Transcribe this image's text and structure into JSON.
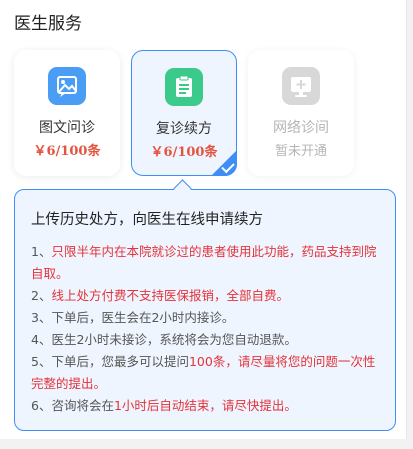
{
  "section_title": "医生服务",
  "services": [
    {
      "label": "图文问诊",
      "price": "￥6/100条",
      "icon": "image-chat-icon",
      "color": "#4a9df5",
      "state": "normal"
    },
    {
      "label": "复诊续方",
      "price": "￥6/100条",
      "icon": "prescription-icon",
      "color": "#3cc98c",
      "state": "selected"
    },
    {
      "label": "网络诊间",
      "price": "暂未开通",
      "icon": "video-room-icon",
      "color": "#d8d8d8",
      "state": "disabled"
    }
  ],
  "info": {
    "title": "上传历史处方，向医生在线申请续方",
    "items": [
      {
        "num": "1、",
        "parts": [
          {
            "t": "只限半年内在本院就诊过的患者使用此功能，药品支持到院自取。",
            "red": true
          }
        ]
      },
      {
        "num": "2、",
        "parts": [
          {
            "t": "线上处方付费不支持医保报销，全部自费。",
            "red": true
          }
        ]
      },
      {
        "num": "3、",
        "parts": [
          {
            "t": "下单后，医生会在2小时内接诊。",
            "red": false
          }
        ]
      },
      {
        "num": "4、",
        "parts": [
          {
            "t": "医生2小时未接诊，系统将会为您自动退款。",
            "red": false
          }
        ]
      },
      {
        "num": "5、",
        "parts": [
          {
            "t": "下单后，您最多可以提问",
            "red": false
          },
          {
            "t": "100条，请尽量将您的问题一次性完整的提出。",
            "red": true
          }
        ]
      },
      {
        "num": "6、",
        "parts": [
          {
            "t": "咨询将会在",
            "red": false
          },
          {
            "t": "1小时后自动结束，请尽快提出。",
            "red": true
          }
        ]
      }
    ]
  }
}
